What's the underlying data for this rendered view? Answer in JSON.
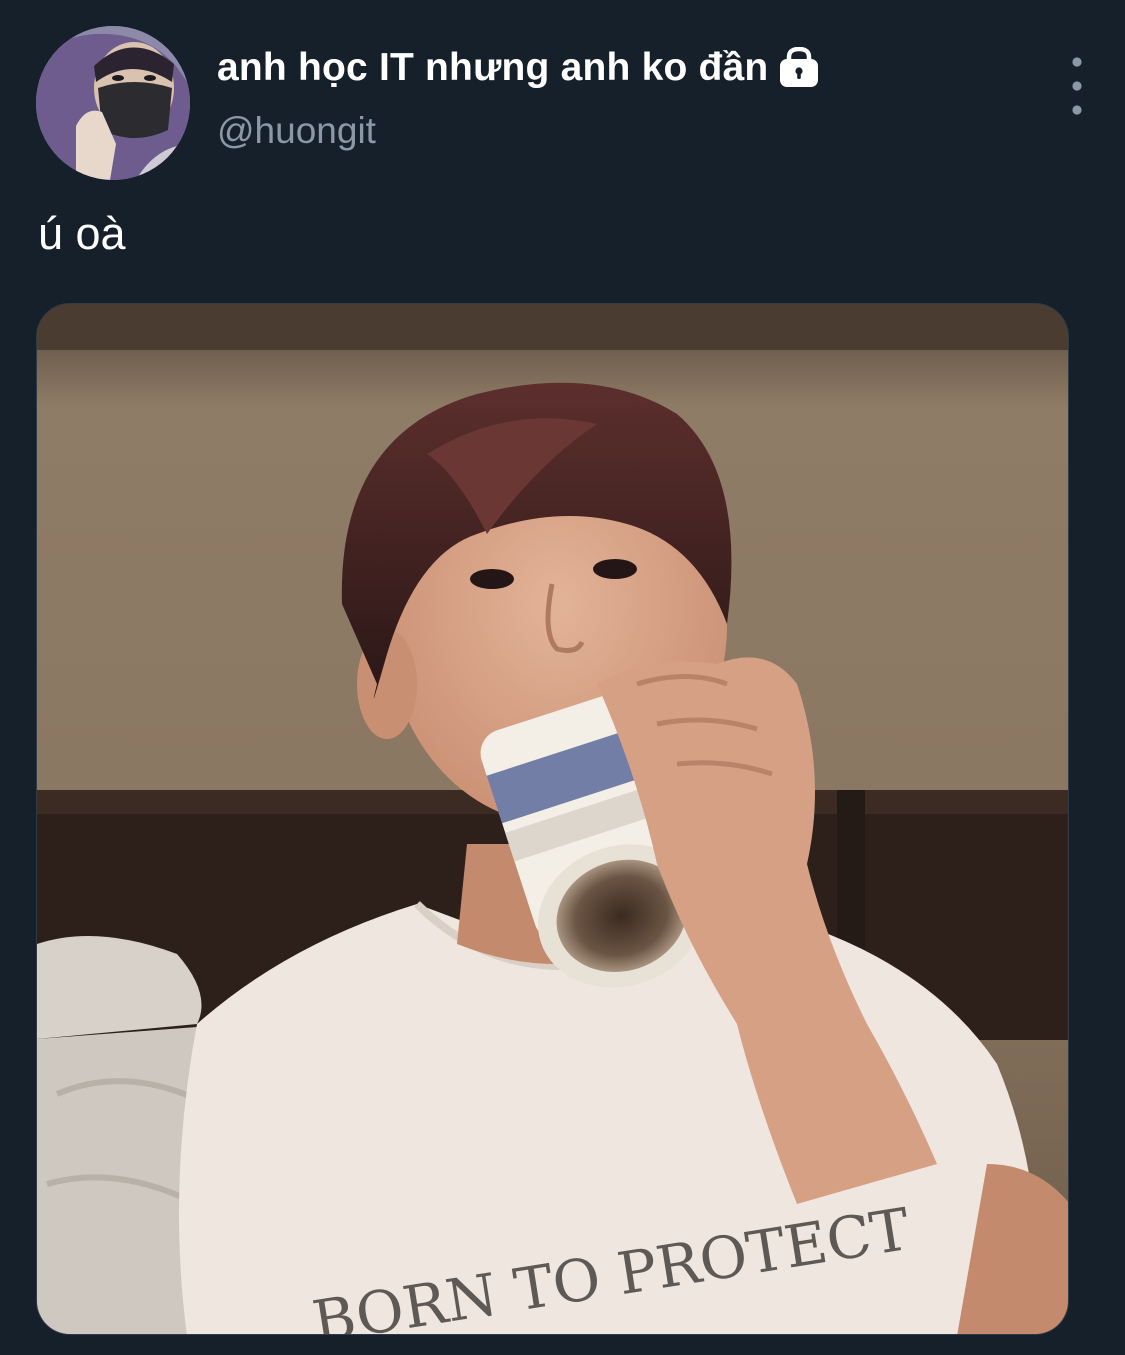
{
  "tweet": {
    "author": {
      "display_name": "anh học IT nhưng anh ko đần",
      "handle": "@huongit",
      "protected_icon": "lock-icon",
      "avatar_icon": "avatar-photo"
    },
    "text": "ú oà",
    "menu_icon": "more-vertical-icon",
    "media": {
      "kind": "photo",
      "shirt_text": "BORN TO PROTECT"
    }
  },
  "colors": {
    "background": "#15202b",
    "text": "#ffffff",
    "secondary_text": "#8b98a5"
  }
}
